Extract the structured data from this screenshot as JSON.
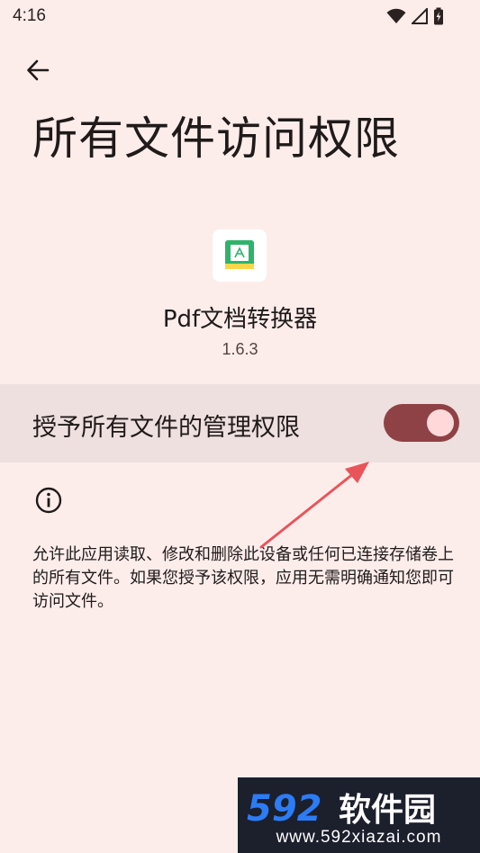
{
  "status_bar": {
    "time": "4:16",
    "icons": [
      "wifi-icon",
      "signal-icon",
      "battery-icon"
    ]
  },
  "header": {
    "back_icon": "arrow-left-icon",
    "title": "所有文件访问权限"
  },
  "app": {
    "icon": "pdf-app-icon",
    "name": "Pdf文档转换器",
    "version": "1.6.3"
  },
  "permission": {
    "label": "授予所有文件的管理权限",
    "enabled": true
  },
  "info": {
    "icon": "info-icon",
    "description": "允许此应用读取、修改和删除此设备或任何已连接存储卷上的所有文件。如果您授予该权限，应用无需明确通知您即可访问文件。"
  },
  "watermark": {
    "logo_text": "592软件园",
    "url": "www.592xiazai.com"
  },
  "colors": {
    "background": "#FCEDEB",
    "row_background": "#EDE0DE",
    "toggle_track": "#8F4246",
    "toggle_thumb": "#FFD9DA",
    "annotation_arrow": "#E9545A",
    "watermark_bg": "#1C1F2C",
    "watermark_blue": "#2B7CF5"
  }
}
